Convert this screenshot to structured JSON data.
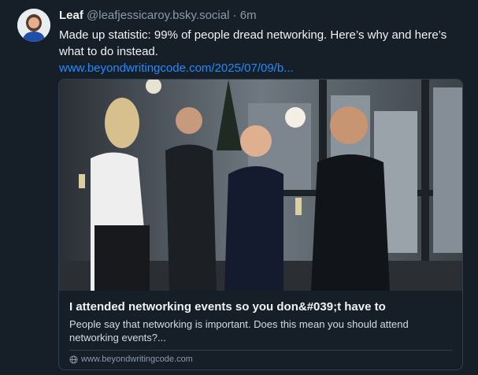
{
  "post": {
    "author_name": "Leaf",
    "author_handle": "@leafjessicaroy.bsky.social",
    "separator": "·",
    "time": "6m",
    "text": "Made up statistic: 99% of people dread networking. Here’s why and here’s what to do instead.",
    "link": "www.beyondwritingcode.com/2025/07/09/b..."
  },
  "card": {
    "title": "I attended networking events so you don&#039;t have to",
    "description": "People say that networking is important. Does this mean you should attend networking events?...",
    "domain": "www.beyondwritingcode.com",
    "domain_icon": "globe-icon"
  },
  "colors": {
    "background": "#161e27",
    "link": "#208bfe",
    "border": "#2e4052",
    "muted": "#8c9aab"
  }
}
